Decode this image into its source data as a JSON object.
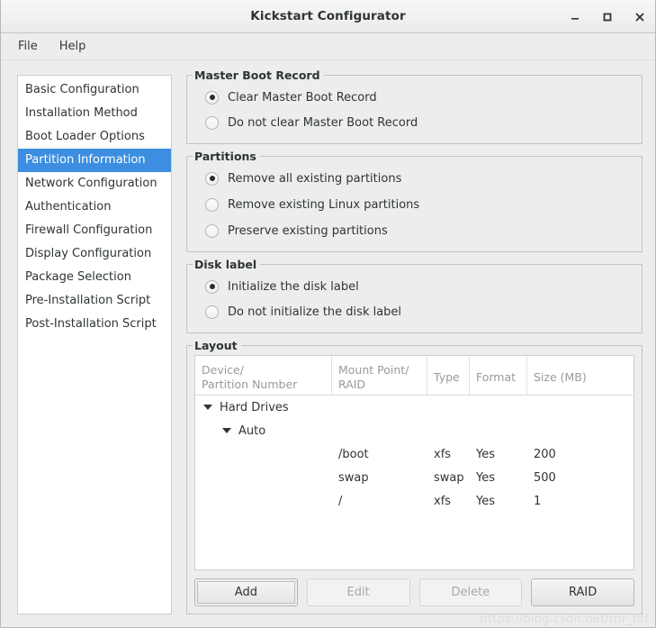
{
  "window": {
    "title": "Kickstart Configurator",
    "controls": [
      {
        "name": "minimize",
        "glyph": "minimize-icon"
      },
      {
        "name": "maximize",
        "glyph": "maximize-icon"
      },
      {
        "name": "close",
        "glyph": "close-icon"
      }
    ]
  },
  "menubar": {
    "items": [
      {
        "label": "File"
      },
      {
        "label": "Help"
      }
    ]
  },
  "sidebar": {
    "items": [
      {
        "label": "Basic Configuration",
        "selected": false
      },
      {
        "label": "Installation Method",
        "selected": false
      },
      {
        "label": "Boot Loader Options",
        "selected": false
      },
      {
        "label": "Partition Information",
        "selected": true
      },
      {
        "label": "Network Configuration",
        "selected": false
      },
      {
        "label": "Authentication",
        "selected": false
      },
      {
        "label": "Firewall Configuration",
        "selected": false
      },
      {
        "label": "Display Configuration",
        "selected": false
      },
      {
        "label": "Package Selection",
        "selected": false
      },
      {
        "label": "Pre-Installation Script",
        "selected": false
      },
      {
        "label": "Post-Installation Script",
        "selected": false
      }
    ],
    "selection_color": "#3d8ee0"
  },
  "master_boot_record": {
    "title": "Master Boot Record",
    "options": [
      {
        "label": "Clear Master Boot Record",
        "checked": true
      },
      {
        "label": "Do not clear Master Boot Record",
        "checked": false
      }
    ]
  },
  "partitions": {
    "title": "Partitions",
    "options": [
      {
        "label": "Remove all existing partitions",
        "checked": true
      },
      {
        "label": "Remove existing Linux partitions",
        "checked": false
      },
      {
        "label": "Preserve existing partitions",
        "checked": false
      }
    ]
  },
  "disk_label": {
    "title": "Disk label",
    "options": [
      {
        "label": "Initialize the disk label",
        "checked": true
      },
      {
        "label": "Do not initialize the disk label",
        "checked": false
      }
    ]
  },
  "layout": {
    "title": "Layout",
    "columns": [
      {
        "label": "Device/\nPartition Number"
      },
      {
        "label": "Mount Point/\nRAID"
      },
      {
        "label": "Type"
      },
      {
        "label": "Format"
      },
      {
        "label": "Size (MB)"
      }
    ],
    "rows": [
      {
        "device": "Hard Drives",
        "mount": "",
        "type": "",
        "format": "",
        "size": "",
        "level": 1,
        "expander": true
      },
      {
        "device": "Auto",
        "mount": "",
        "type": "",
        "format": "",
        "size": "",
        "level": 2,
        "expander": true
      },
      {
        "device": "",
        "mount": "/boot",
        "type": "xfs",
        "format": "Yes",
        "size": "200",
        "level": 3,
        "expander": false
      },
      {
        "device": "",
        "mount": "swap",
        "type": "swap",
        "format": "Yes",
        "size": "500",
        "level": 3,
        "expander": false
      },
      {
        "device": "",
        "mount": "/",
        "type": "xfs",
        "format": "Yes",
        "size": "1",
        "level": 3,
        "expander": false
      }
    ],
    "buttons": [
      {
        "label": "Add",
        "state": "focused"
      },
      {
        "label": "Edit",
        "state": "disabled"
      },
      {
        "label": "Delete",
        "state": "disabled"
      },
      {
        "label": "RAID",
        "state": "normal"
      }
    ]
  },
  "watermark": {
    "text": "https://blog.csdn.net/rnr_fiff"
  }
}
